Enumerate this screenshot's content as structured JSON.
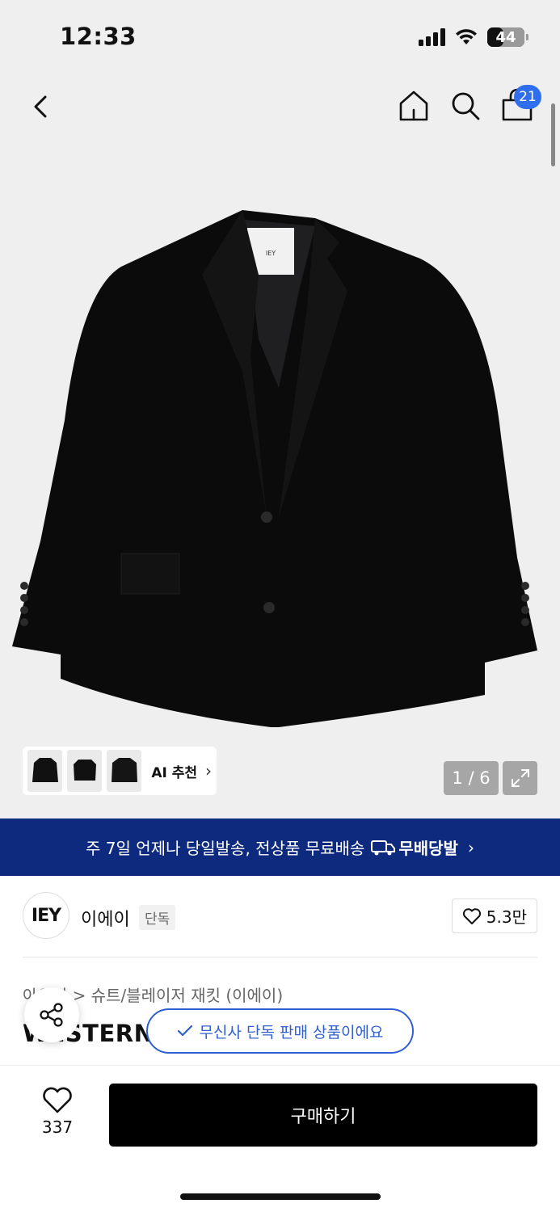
{
  "status_bar": {
    "time": "12:33",
    "battery": "44",
    "battery_level": 0.44
  },
  "header": {
    "cart_count": "21"
  },
  "gallery": {
    "brand_tag": "IEY",
    "ai_label": "AI 추천",
    "page_indicator": "1 / 6"
  },
  "banner": {
    "text": "주 7일 언제나 당일발송, 전상품 무료배송",
    "badge": "무배당발"
  },
  "brand": {
    "logo_text": "IEY",
    "name": "이에이",
    "tag": "단독",
    "likes": "5.3만"
  },
  "product": {
    "breadcrumb_prefix": "아우터",
    "breadcrumb_rest": "> 슈트/블레이저 재킷 (이에이)",
    "title": "WESTERN"
  },
  "toast": {
    "text": "무신사 단독 판매 상품이에요"
  },
  "bottom": {
    "wish_count": "337",
    "buy_label": "구매하기"
  },
  "colors": {
    "banner_bg": "#0d2a7e",
    "accent": "#2f5fd0",
    "badge": "#2f6fed"
  }
}
